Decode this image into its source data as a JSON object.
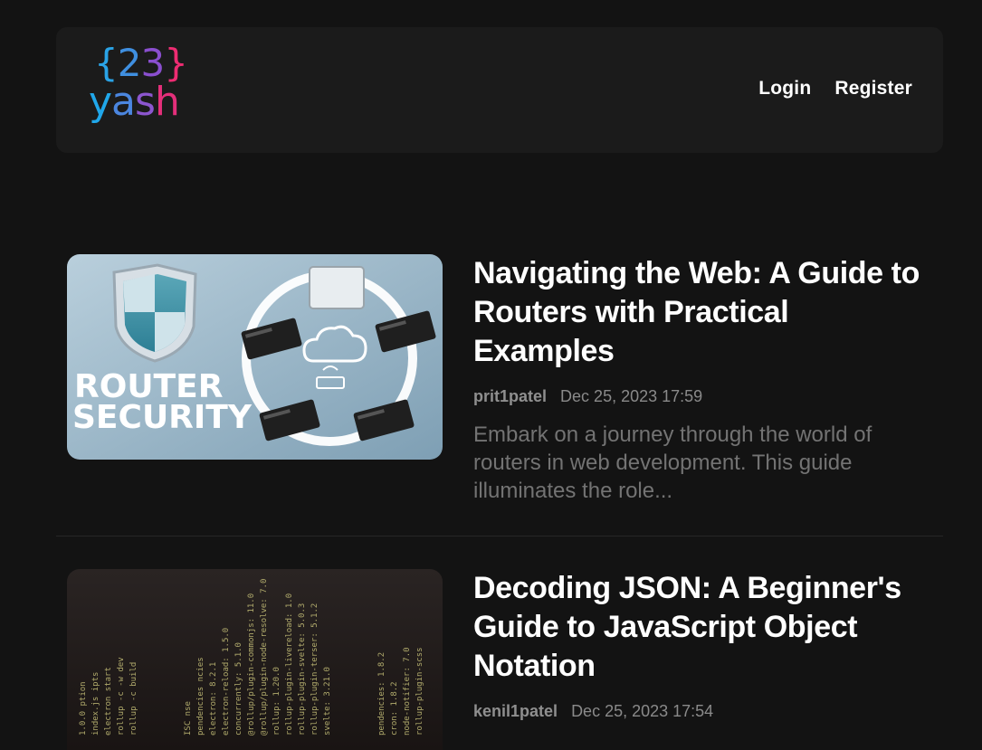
{
  "header": {
    "logo": {
      "line1_open": "{",
      "line1_a": "2",
      "line1_b": "3",
      "line1_close": "}",
      "line2": "yash"
    },
    "nav": {
      "login": "Login",
      "register": "Register"
    }
  },
  "posts": [
    {
      "title": "Navigating the Web: A Guide to Routers with Practical Examples",
      "author": "prit1patel",
      "date": "Dec 25, 2023 17:59",
      "excerpt": "Embark on a journey through the world of routers in web development. This guide illuminates the role...",
      "image": {
        "text_line1": "ROUTER",
        "text_line2": "SECURITY"
      }
    },
    {
      "title": "Decoding JSON: A Beginner's Guide to JavaScript Object Notation",
      "author": "kenil1patel",
      "date": "Dec 25, 2023 17:54"
    }
  ],
  "colors": {
    "background": "#131313",
    "header": "#1b1b1b",
    "muted": "#737373"
  }
}
